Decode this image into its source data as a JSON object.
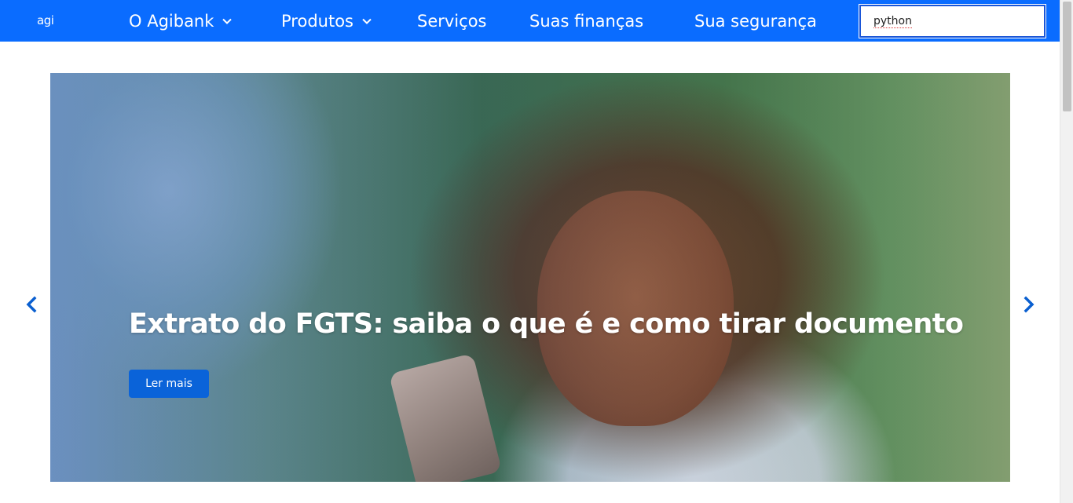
{
  "header": {
    "logo_text": "agi",
    "nav": [
      {
        "label": "O Agibank",
        "has_dropdown": true
      },
      {
        "label": "Produtos",
        "has_dropdown": true
      },
      {
        "label": "Serviços",
        "has_dropdown": false
      },
      {
        "label": "Suas finanças",
        "has_dropdown": false
      },
      {
        "label": "Sua segurança",
        "has_dropdown": false
      }
    ],
    "search": {
      "value": "python"
    }
  },
  "hero": {
    "title": "Extrato do FGTS: saiba o que é e como tirar documento",
    "cta_label": "Ler mais",
    "prev_icon": "chevron-left-icon",
    "next_icon": "chevron-right-icon"
  },
  "colors": {
    "nav_bg": "#0a6cff",
    "cta_bg": "#0a63d9",
    "arrow_color": "#0a5fd0"
  }
}
